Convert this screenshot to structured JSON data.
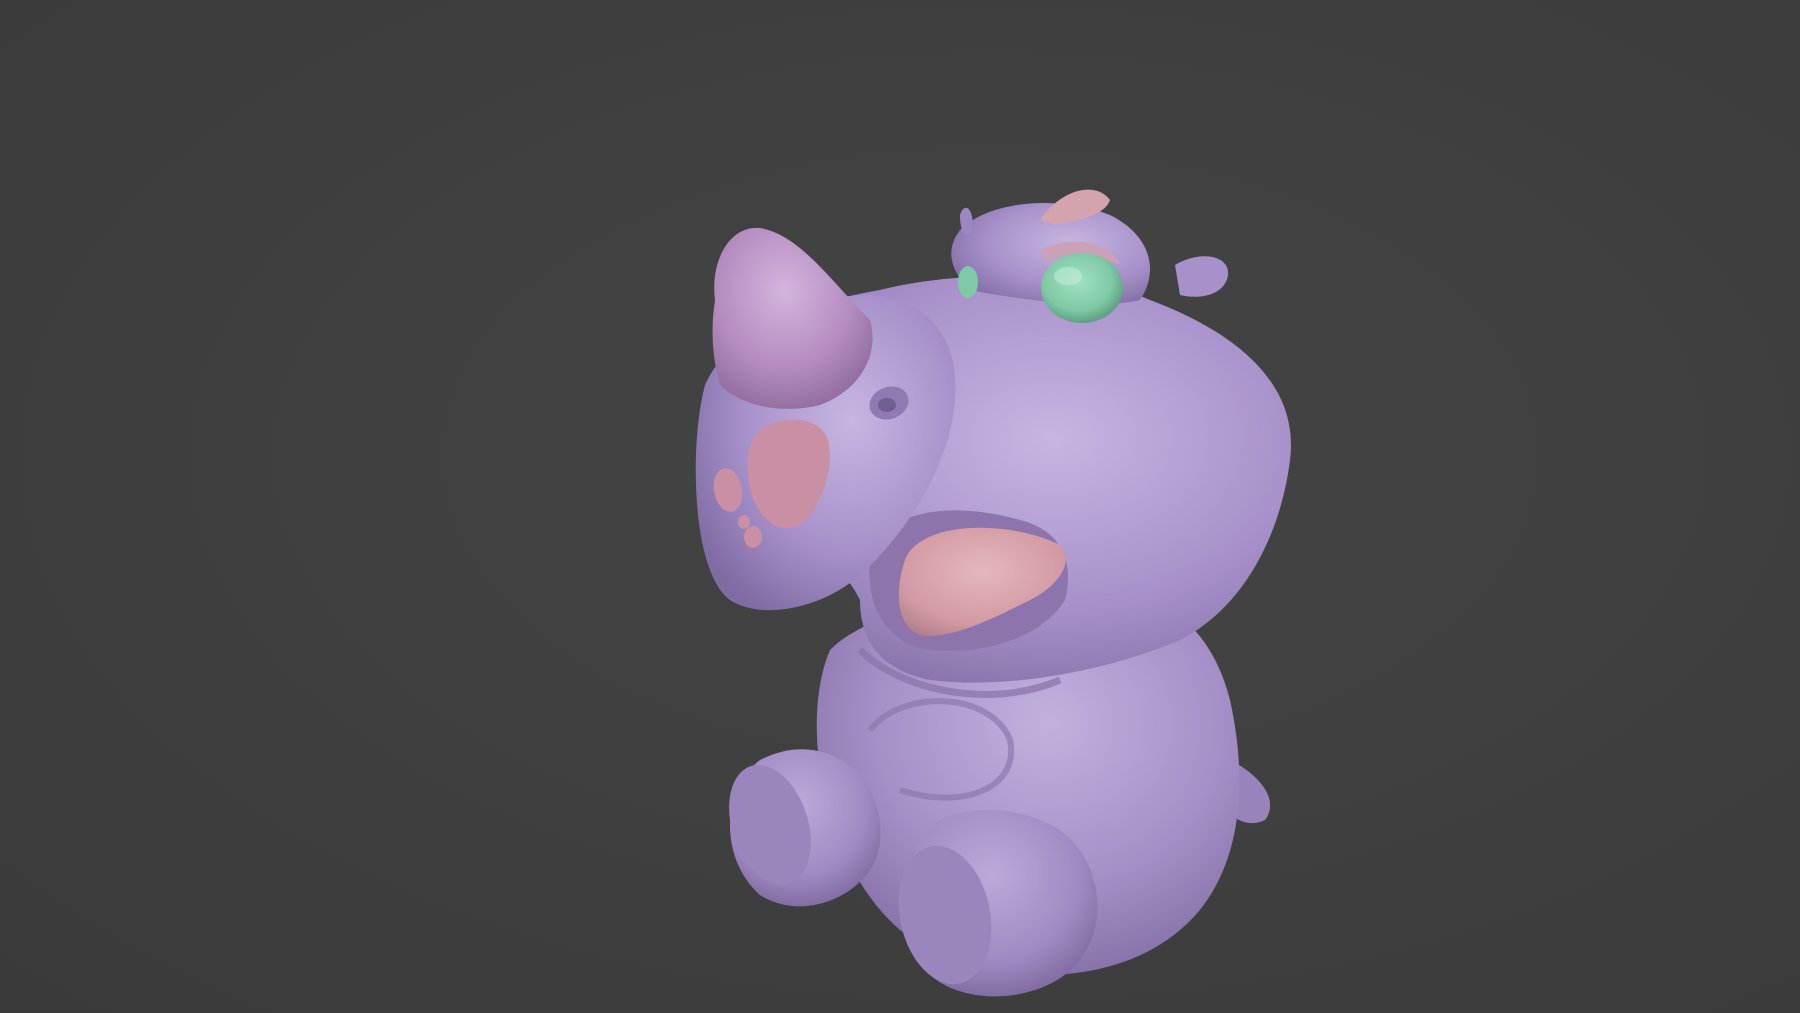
{
  "scene": {
    "background_color": "#3d3d3d",
    "subject": "rhino-character-sculpt",
    "colors": {
      "body": "#a58fc8",
      "body_shadow": "#7d6aa0",
      "body_highlight": "#c4b3de",
      "horn": "#b48cc0",
      "spots": "#c98fa4",
      "tongue": "#d7a0a8",
      "mouth_inner": "#8d6fa6",
      "eye": "#7ec9a6",
      "ear_inner": "#d6a3ad"
    }
  }
}
